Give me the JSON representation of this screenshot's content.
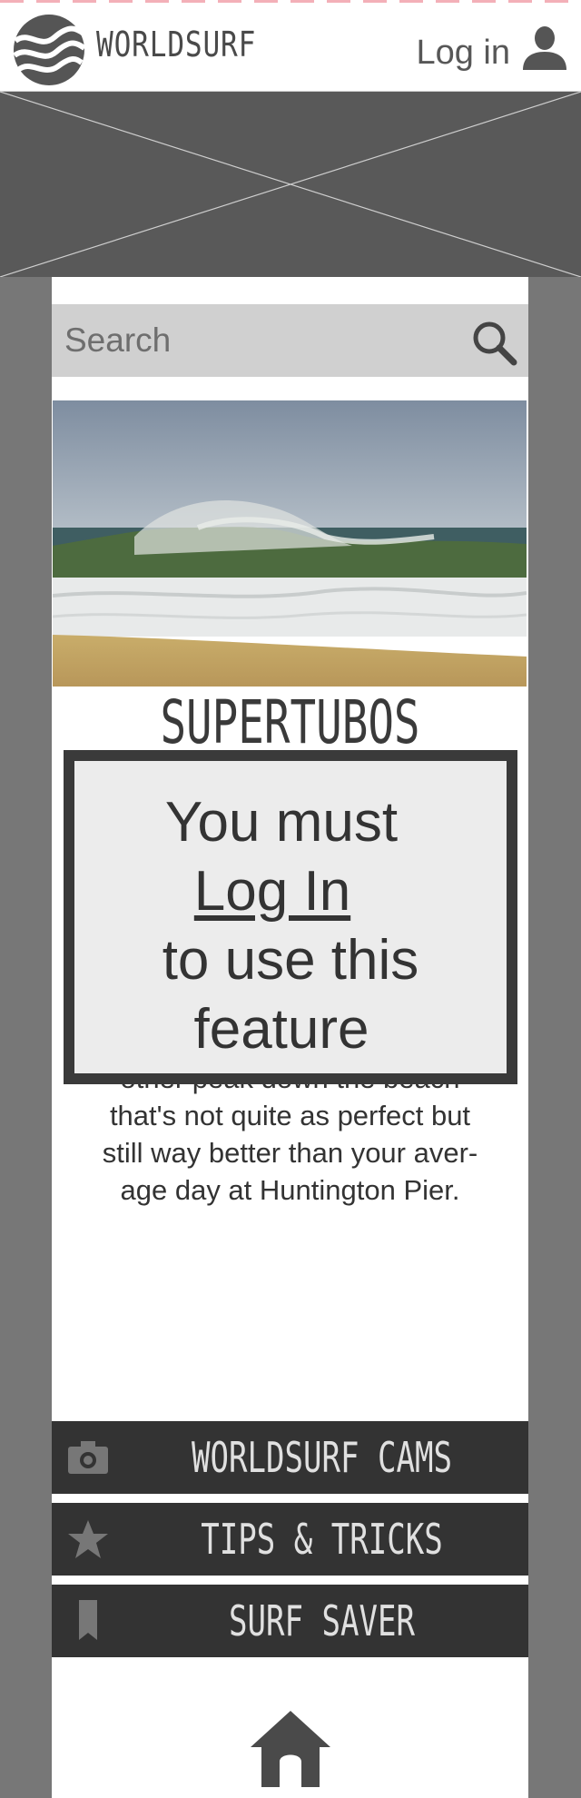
{
  "header": {
    "brand": "WORLDSURF",
    "login_label": "Log in"
  },
  "search": {
    "placeholder": "Search"
  },
  "spot": {
    "title": "SUPERTUBOS",
    "description": "other peak down the beach\nthat's not quite as perfect but\nstill way better than your aver-\nage day at Huntington Pier."
  },
  "modal": {
    "line1": "You must",
    "link": "Log In",
    "line3": "to use this",
    "line4": "feature"
  },
  "menu": {
    "cams_label": "WORLDSURF CAMS",
    "tips_label": "TIPS & TRICKS",
    "saver_label": "SURF SAVER"
  },
  "colors": {
    "sidebar": "#777777",
    "banner": "#595959",
    "menu_bg": "#333333",
    "modal_border": "#3a3a3a",
    "modal_bg": "#ececec"
  },
  "icons": [
    "wave-logo-icon",
    "user-icon",
    "search-icon",
    "camera-icon",
    "star-icon",
    "bookmark-icon",
    "home-icon"
  ]
}
